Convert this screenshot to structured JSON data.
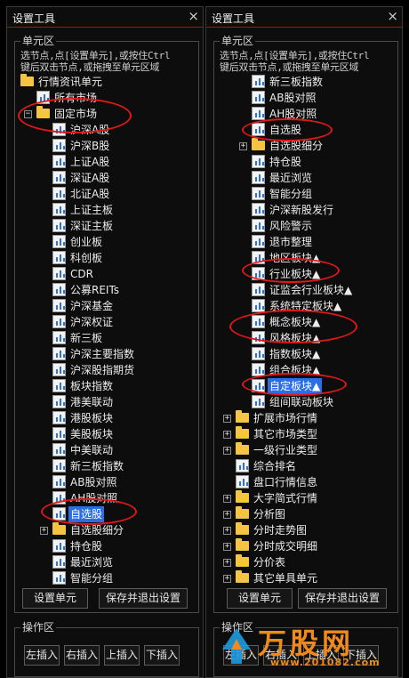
{
  "left_panel": {
    "title": "设置工具",
    "close": "×",
    "unit_group_title": "单元区",
    "hint_lines": [
      "选节点,点[设置单元],或按住Ctrl",
      "键后双击节点,或拖拽至单元区域"
    ],
    "tree": [
      {
        "text": "行情资讯单元",
        "icon": "folder",
        "level": 0,
        "expander": ""
      },
      {
        "text": "所有市场",
        "icon": "file",
        "level": 1,
        "expander": ""
      },
      {
        "text": "固定市场",
        "icon": "folder",
        "level": 1,
        "expander": "−"
      },
      {
        "text": "沪深A股",
        "icon": "file",
        "level": 2,
        "expander": ""
      },
      {
        "text": "沪深B股",
        "icon": "file",
        "level": 2,
        "expander": ""
      },
      {
        "text": "上证A股",
        "icon": "file",
        "level": 2,
        "expander": ""
      },
      {
        "text": "深证A股",
        "icon": "file",
        "level": 2,
        "expander": ""
      },
      {
        "text": "北证A股",
        "icon": "file",
        "level": 2,
        "expander": ""
      },
      {
        "text": "上证主板",
        "icon": "file",
        "level": 2,
        "expander": ""
      },
      {
        "text": "深证主板",
        "icon": "file",
        "level": 2,
        "expander": ""
      },
      {
        "text": "创业板",
        "icon": "file",
        "level": 2,
        "expander": ""
      },
      {
        "text": "科创板",
        "icon": "file",
        "level": 2,
        "expander": ""
      },
      {
        "text": "CDR",
        "icon": "file",
        "level": 2,
        "expander": ""
      },
      {
        "text": "公募REITs",
        "icon": "file",
        "level": 2,
        "expander": ""
      },
      {
        "text": "沪深基金",
        "icon": "file",
        "level": 2,
        "expander": ""
      },
      {
        "text": "沪深权证",
        "icon": "file",
        "level": 2,
        "expander": ""
      },
      {
        "text": "新三板",
        "icon": "file",
        "level": 2,
        "expander": ""
      },
      {
        "text": "沪深主要指数",
        "icon": "file",
        "level": 2,
        "expander": ""
      },
      {
        "text": "沪深股指期货",
        "icon": "file",
        "level": 2,
        "expander": ""
      },
      {
        "text": "板块指数",
        "icon": "file",
        "level": 2,
        "expander": ""
      },
      {
        "text": "港美联动",
        "icon": "file",
        "level": 2,
        "expander": ""
      },
      {
        "text": "港股板块",
        "icon": "file",
        "level": 2,
        "expander": ""
      },
      {
        "text": "美股板块",
        "icon": "file",
        "level": 2,
        "expander": ""
      },
      {
        "text": "中美联动",
        "icon": "file",
        "level": 2,
        "expander": ""
      },
      {
        "text": "新三板指数",
        "icon": "file",
        "level": 2,
        "expander": ""
      },
      {
        "text": "AB股对照",
        "icon": "file",
        "level": 2,
        "expander": ""
      },
      {
        "text": "AH股对照",
        "icon": "file",
        "level": 2,
        "expander": ""
      },
      {
        "text": "自选股",
        "icon": "file",
        "level": 2,
        "expander": "",
        "selected": true
      },
      {
        "text": "自选股细分",
        "icon": "folder",
        "level": 2,
        "expander": "+"
      },
      {
        "text": "持仓股",
        "icon": "file",
        "level": 2,
        "expander": ""
      },
      {
        "text": "最近浏览",
        "icon": "file",
        "level": 2,
        "expander": ""
      },
      {
        "text": "智能分组",
        "icon": "file",
        "level": 2,
        "expander": ""
      }
    ],
    "set_unit_button": "设置单元",
    "save_exit_button": "保存并退出设置",
    "op_group_title": "操作区",
    "op_buttons": [
      "左插入",
      "右插入",
      "上插入",
      "下插入"
    ]
  },
  "right_panel": {
    "title": "设置工具",
    "close": "×",
    "unit_group_title": "单元区",
    "hint_lines": [
      "选节点,点[设置单元],或按住Ctrl",
      "键后双击节点,或拖拽至单元区域"
    ],
    "tree": [
      {
        "text": "新三板指数",
        "icon": "file",
        "level": 2,
        "expander": ""
      },
      {
        "text": "AB股对照",
        "icon": "file",
        "level": 2,
        "expander": ""
      },
      {
        "text": "AH股对照",
        "icon": "file",
        "level": 2,
        "expander": ""
      },
      {
        "text": "自选股",
        "icon": "file",
        "level": 2,
        "expander": ""
      },
      {
        "text": "自选股细分",
        "icon": "folder",
        "level": 2,
        "expander": "+"
      },
      {
        "text": "持仓股",
        "icon": "file",
        "level": 2,
        "expander": ""
      },
      {
        "text": "最近浏览",
        "icon": "file",
        "level": 2,
        "expander": ""
      },
      {
        "text": "智能分组",
        "icon": "file",
        "level": 2,
        "expander": ""
      },
      {
        "text": "沪深新股发行",
        "icon": "file",
        "level": 2,
        "expander": ""
      },
      {
        "text": "风险警示",
        "icon": "file",
        "level": 2,
        "expander": ""
      },
      {
        "text": "退市整理",
        "icon": "file",
        "level": 2,
        "expander": ""
      },
      {
        "text": "地区板块▲",
        "icon": "file",
        "level": 2,
        "expander": ""
      },
      {
        "text": "行业板块▲",
        "icon": "file",
        "level": 2,
        "expander": ""
      },
      {
        "text": "证监会行业板块▲",
        "icon": "file",
        "level": 2,
        "expander": ""
      },
      {
        "text": "系统特定板块▲",
        "icon": "file",
        "level": 2,
        "expander": ""
      },
      {
        "text": "概念板块▲",
        "icon": "file",
        "level": 2,
        "expander": ""
      },
      {
        "text": "风格板块▲",
        "icon": "file",
        "level": 2,
        "expander": ""
      },
      {
        "text": "指数板块▲",
        "icon": "file",
        "level": 2,
        "expander": ""
      },
      {
        "text": "组合板块▲",
        "icon": "file",
        "level": 2,
        "expander": ""
      },
      {
        "text": "自定板块▲",
        "icon": "file",
        "level": 2,
        "expander": "",
        "selected": true
      },
      {
        "text": "组间联动板块",
        "icon": "file",
        "level": 2,
        "expander": ""
      },
      {
        "text": "扩展市场行情",
        "icon": "folder",
        "level": 1,
        "expander": "+"
      },
      {
        "text": "其它市场类型",
        "icon": "folder",
        "level": 1,
        "expander": "+"
      },
      {
        "text": "一级行业类型",
        "icon": "folder",
        "level": 1,
        "expander": "+"
      },
      {
        "text": "综合排名",
        "icon": "file",
        "level": 1,
        "expander": ""
      },
      {
        "text": "盘口行情信息",
        "icon": "file",
        "level": 1,
        "expander": ""
      },
      {
        "text": "大字简式行情",
        "icon": "folder",
        "level": 1,
        "expander": "+"
      },
      {
        "text": "分析图",
        "icon": "folder",
        "level": 1,
        "expander": "+"
      },
      {
        "text": "分时走势图",
        "icon": "folder",
        "level": 1,
        "expander": "+"
      },
      {
        "text": "分时成交明细",
        "icon": "folder",
        "level": 1,
        "expander": "+"
      },
      {
        "text": "分价表",
        "icon": "folder",
        "level": 1,
        "expander": "+"
      },
      {
        "text": "其它单具单元",
        "icon": "folder",
        "level": 1,
        "expander": "+"
      }
    ],
    "set_unit_button": "设置单元",
    "save_exit_button": "保存并退出设置",
    "op_group_title": "操作区",
    "op_buttons": [
      "左插入",
      "右插入",
      "上插入",
      "下插入"
    ]
  },
  "watermark": {
    "logo_text": "万股网",
    "url_text": "www.201082.com"
  }
}
